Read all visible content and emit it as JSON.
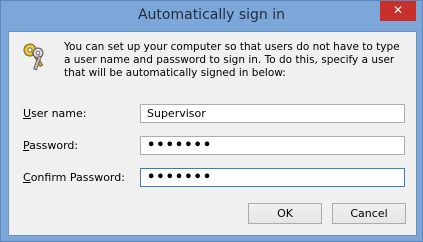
{
  "window": {
    "title": "Automatically sign in",
    "close_glyph": "✕"
  },
  "description": "You can set up your computer so that users do not have to type a user name and password to sign in. To do this, specify a user that will be automatically signed in below:",
  "icon": "keys-icon",
  "form": {
    "username": {
      "accesskey": "U",
      "label_rest": "ser name:",
      "value": "Supervisor"
    },
    "password": {
      "accesskey": "P",
      "label_rest": "assword:",
      "value": "•••••••"
    },
    "confirm": {
      "accesskey": "C",
      "label_rest": "onfirm Password:",
      "value": "•••••••"
    }
  },
  "buttons": {
    "ok": "OK",
    "cancel": "Cancel"
  },
  "colors": {
    "frame": "#7da7d9",
    "close": "#c7302b",
    "client": "#f0f0f0"
  }
}
